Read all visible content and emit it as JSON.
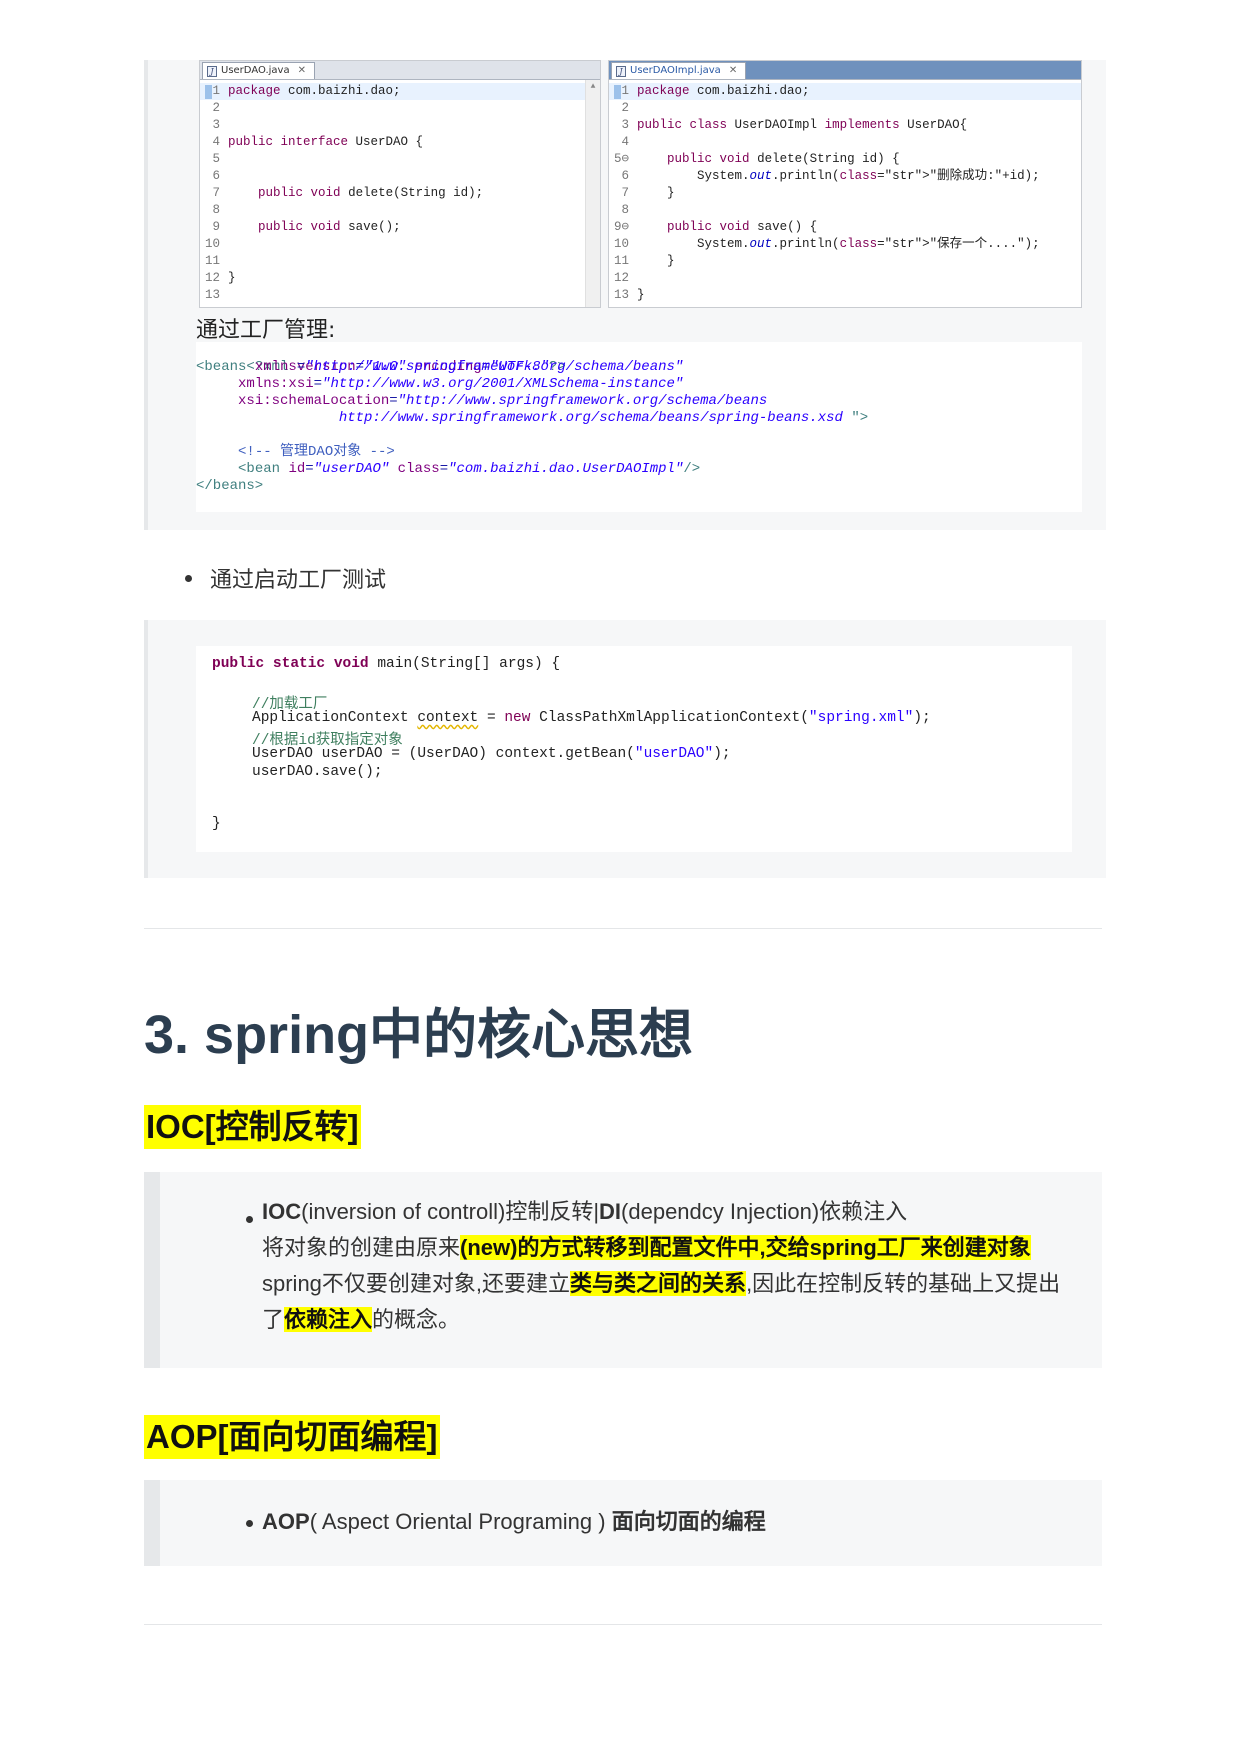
{
  "editors": {
    "left": {
      "tab_label": "UserDAO.java",
      "lines": [
        {
          "n": "1",
          "t": "package com.baizhi.dao;"
        },
        {
          "n": "2",
          "t": ""
        },
        {
          "n": "3",
          "t": ""
        },
        {
          "n": "4",
          "t": "public interface UserDAO {"
        },
        {
          "n": "5",
          "t": ""
        },
        {
          "n": "6",
          "t": ""
        },
        {
          "n": "7",
          "t": "    public void delete(String id);"
        },
        {
          "n": "8",
          "t": ""
        },
        {
          "n": "9",
          "t": "    public void save();"
        },
        {
          "n": "10",
          "t": ""
        },
        {
          "n": "11",
          "t": ""
        },
        {
          "n": "12",
          "t": "}"
        },
        {
          "n": "13",
          "t": ""
        }
      ]
    },
    "right": {
      "tab_label": "UserDAOImpl.java",
      "lines": [
        {
          "n": "1",
          "t": "package com.baizhi.dao;"
        },
        {
          "n": "2",
          "t": ""
        },
        {
          "n": "3",
          "t": "public class UserDAOImpl implements UserDAO{"
        },
        {
          "n": "4",
          "t": ""
        },
        {
          "n": "5⊖",
          "t": "    public void delete(String id) {"
        },
        {
          "n": "6",
          "t": "        System.out.println(\"删除成功:\"+id);"
        },
        {
          "n": "7",
          "t": "    }"
        },
        {
          "n": "8",
          "t": ""
        },
        {
          "n": "9⊖",
          "t": "    public void save() {"
        },
        {
          "n": "10",
          "t": "        System.out.println(\"保存一个....\");"
        },
        {
          "n": "11",
          "t": "    }"
        },
        {
          "n": "12",
          "t": ""
        },
        {
          "n": "13",
          "t": "}"
        }
      ]
    }
  },
  "factory_label": "通过工厂管理:",
  "xml": {
    "line1": {
      "open": "<?xml ",
      "a1": "version",
      "v1": "\"1.0\"",
      "a2": " encoding",
      "v2": "\"UTF-8\"",
      "close": "?>"
    },
    "line2": {
      "tag": "<beans ",
      "attr": "xmlns",
      "val": "\"http://www.springframework.org/schema/beans\""
    },
    "line3": {
      "attr": "xmlns:xsi",
      "val": "\"http://www.w3.org/2001/XMLSchema-instance\""
    },
    "line4": {
      "attr": "xsi:schemaLocation",
      "val": "\"http://www.springframework.org/schema/beans"
    },
    "line5": {
      "val": "http://www.springframework.org/schema/beans/spring-beans.xsd ",
      "close": "\">"
    },
    "comment": "<!-- 管理DAO对象 -->",
    "bean": {
      "tag": "<bean ",
      "a1": "id",
      "v1": "\"userDAO\"",
      "a2": " class",
      "v2": "\"com.baizhi.dao.UserDAOImpl\"",
      "close": "/>"
    },
    "end": "</beans>"
  },
  "bullet_test": "通过启动工厂测试",
  "main_code": {
    "sig": {
      "kw": "public static void",
      "rest": " main(String[] args) {"
    },
    "comment1": "//加载工厂",
    "ctx": {
      "type": "ApplicationContext ",
      "var": "context",
      "eq": " = ",
      "new": "new",
      "call": " ClassPathXmlApplicationContext(",
      "str": "\"spring.xml\"",
      "end": ");"
    },
    "comment2": "//根据id获取指定对象",
    "get": {
      "pre": "UserDAO userDAO = (UserDAO) context.getBean(",
      "str": "\"userDAO\"",
      "end": ");"
    },
    "save": "userDAO.save();",
    "close": "}"
  },
  "section_title": "3. spring中的核心思想",
  "ioc": {
    "heading": "IOC[控制反转]",
    "s1_bold": "IOC",
    "s2": "(inversion of controll)控制反转|",
    "s3_bold": "DI",
    "s4": "(dependcy Injection)依赖注入",
    "s5": "将对象的创建由原来",
    "s6_mark": "(new)的方式转移到配置文件中,交给spring工厂来创建对象",
    "s7": "spring不仅要创建对象,还要建立",
    "s8_mark": "类与类之间的关系",
    "s9": ",因此在控制反转的基础上又提出了",
    "s10_mark": "依赖注入",
    "s11": "的概念。"
  },
  "aop": {
    "heading": "AOP[面向切面编程]",
    "s1_bold": "AOP",
    "s2": "( Aspect Oriental Programing )",
    "s3_bold": "面向切面的编程"
  }
}
